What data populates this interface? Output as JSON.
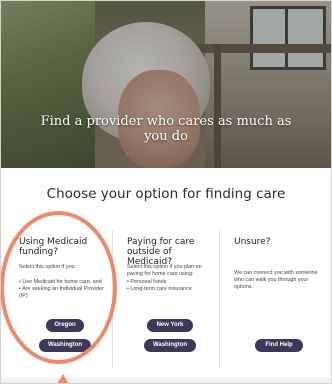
{
  "hero": {
    "title": "Find a provider who cares as much as you do"
  },
  "section": {
    "title": "Choose your option for finding care"
  },
  "options": [
    {
      "heading": "Using Medicaid funding?",
      "description": "Select this option if you:",
      "bullets": [
        "• Use Medicaid for home care, and",
        "• Are seeking an Individual Provider (IP)"
      ],
      "buttons": [
        "Oregon",
        "Washington"
      ]
    },
    {
      "heading": "Paying for care outside of Medicaid?",
      "description": "Select this option if you plan on paying for home care using:",
      "bullets": [
        "• Personal funds",
        "• Long-term care insurance"
      ],
      "buttons": [
        "New York",
        "Washington"
      ]
    },
    {
      "heading": "Unsure?",
      "description": "We can connect you with someone who can walk you through your options.",
      "buttons": [
        "Find Help"
      ]
    }
  ],
  "colors": {
    "button": "#3e3759",
    "highlight": "#ec8b6b"
  }
}
